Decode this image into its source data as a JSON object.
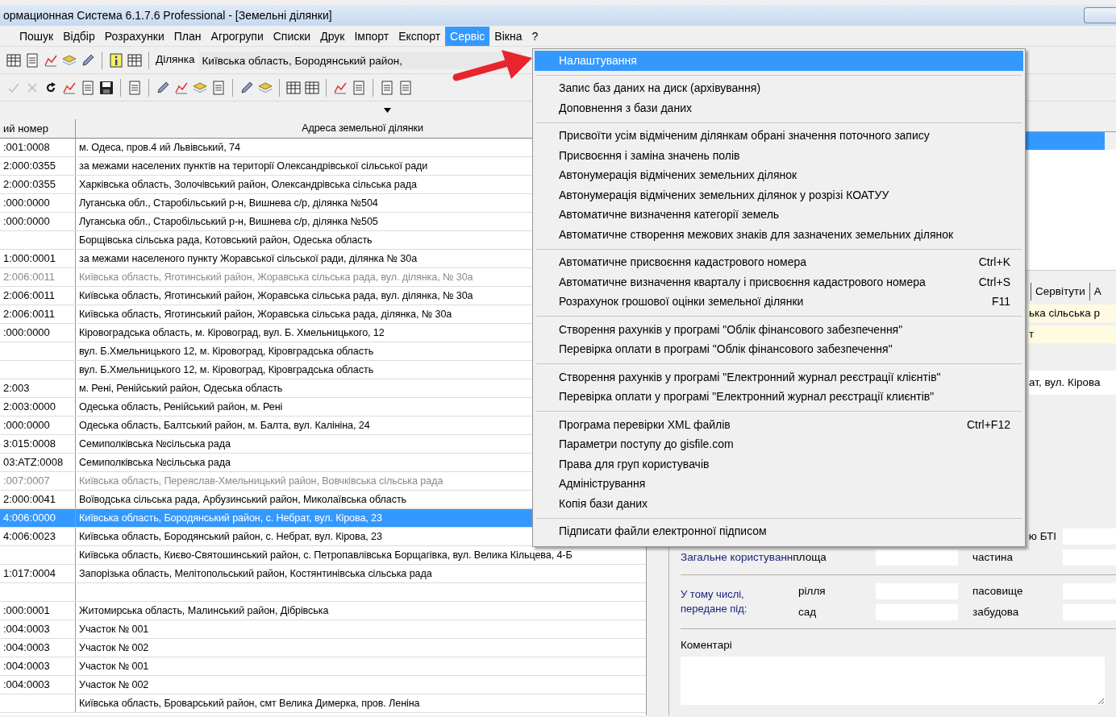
{
  "window": {
    "title": "ормационная Система 6.1.7.6 Professional - [Земельні ділянки]"
  },
  "menubar": [
    {
      "label": "Пошук",
      "selected": false
    },
    {
      "label": "Відбір",
      "selected": false
    },
    {
      "label": "Розрахунки",
      "selected": false
    },
    {
      "label": "План",
      "selected": false
    },
    {
      "label": "Агрогрупи",
      "selected": false
    },
    {
      "label": "Списки",
      "selected": false
    },
    {
      "label": "Друк",
      "selected": false
    },
    {
      "label": "Імпорт",
      "selected": false
    },
    {
      "label": "Експорт",
      "selected": false
    },
    {
      "label": "Сервіс",
      "selected": true
    },
    {
      "label": "Вікна",
      "selected": false
    },
    {
      "label": "?",
      "selected": false
    }
  ],
  "toolbar": {
    "plot_label": "Ділянка",
    "plot_value": "Київська область, Бородянський район,"
  },
  "table": {
    "columns": [
      "ий номер",
      "Адреса земельної ділянки"
    ],
    "rows": [
      {
        "number": ":001:0008",
        "address": "м. Одеса, пров.4 ий Львівський, 74",
        "muted": false,
        "selected": false
      },
      {
        "number": "2:000:0355",
        "address": "за межами населених пунктів на території Олександрівської сільської ради",
        "muted": false,
        "selected": false
      },
      {
        "number": "2:000:0355",
        "address": "Харківська область, Золочівський район, Олександрівська сільська рада",
        "muted": false,
        "selected": false
      },
      {
        "number": ":000:0000",
        "address": "Луганська обл., Старобільський р-н, Вишнева с/р, ділянка №504",
        "muted": false,
        "selected": false
      },
      {
        "number": ":000:0000",
        "address": "Луганська обл., Старобільський р-н, Вишнева с/р, ділянка №505",
        "muted": false,
        "selected": false
      },
      {
        "address": "Борщівська сільська рада, Котовський район, Одеська область",
        "muted": false,
        "selected": false
      },
      {
        "number": "1:000:0001",
        "address": "за межами населеного пункту Жоравської сільської ради, ділянка № 30а",
        "muted": false,
        "selected": false
      },
      {
        "number": "2:006:0011",
        "address": "Київська область, Яготинський район, Жоравська сільська рада, вул. ділянка, № 30а",
        "muted": true,
        "selected": false
      },
      {
        "number": "2:006:0011",
        "address": "Київська область, Яготинський район, Жоравська сільська рада, вул. ділянка, № 30а",
        "muted": false,
        "selected": false
      },
      {
        "number": "2:006:0011",
        "address": "Київська область, Яготинський район, Жоравська сільська рада,  ділянка, № 30а",
        "muted": false,
        "selected": false
      },
      {
        "number": ":000:0000",
        "address": "Кіровоградська область, м. Кіровоград, вул. Б. Хмельницького, 12",
        "muted": false,
        "selected": false
      },
      {
        "address": "вул. Б.Хмельницького 12, м. Кіровоград, Кіровградська область",
        "muted": false,
        "selected": false
      },
      {
        "address": "вул. Б.Хмельницького 12, м. Кіровоград, Кіровградська область",
        "muted": false,
        "selected": false
      },
      {
        "number": "2:003",
        "address": "м. Рені, Ренійський район, Одеська область",
        "muted": false,
        "selected": false
      },
      {
        "number": "2:003:0000",
        "address": "Одеська область, Ренійський район, м. Рені",
        "muted": false,
        "selected": false
      },
      {
        "number": ":000:0000",
        "address": "Одеська область, Балтський район, м. Балта, вул. Калініна, 24",
        "muted": false,
        "selected": false
      },
      {
        "number": "3:015:0008",
        "address": "Семиполківська №сільська рада",
        "muted": false,
        "selected": false
      },
      {
        "number": "03:ATZ:0008",
        "address": "Семиполківська №сільська рада",
        "muted": false,
        "selected": false
      },
      {
        "number": ":007:0007",
        "address": "Київська область, Переяслав-Хмельницький район, Вовчківська сільська рада",
        "muted": true,
        "selected": false
      },
      {
        "number": "2:000:0041",
        "address": "Воїводська сільська рада, Арбузинський район, Миколаївська область",
        "muted": false,
        "selected": false
      },
      {
        "number": "4:006:0000",
        "address": "Київська область, Бородянський район, с. Небрат, вул. Кірова, 23",
        "muted": false,
        "selected": true
      },
      {
        "number": "4:006:0023",
        "address": "Київська область, Бородянський район, с. Небрат, вул. Кірова, 23",
        "muted": false,
        "selected": false
      },
      {
        "address": "Київська область, Києво-Святошинський район, с. Петропавлівська Борщагівка, вул. Велика Кільцева, 4-Б",
        "muted": false,
        "selected": false
      },
      {
        "number": "1:017:0004",
        "address": "Запорізька область, Мелітопольський район, Костянтинівська сільська рада",
        "muted": false,
        "selected": false
      },
      {
        "selected": false
      },
      {
        "number": ":000:0001",
        "address": "Житомирська область, Малинський район, Дібрівська",
        "muted": false,
        "selected": false
      },
      {
        "number": ":004:0003",
        "address": "Участок № 001",
        "muted": false,
        "selected": false
      },
      {
        "number": ":004:0003",
        "address": "Участок № 002",
        "muted": false,
        "selected": false
      },
      {
        "number": ":004:0003",
        "address": "Участок № 001",
        "muted": false,
        "selected": false
      },
      {
        "number": ":004:0003",
        "address": "Участок № 002",
        "muted": false,
        "selected": false
      },
      {
        "address": "Київська область, Броварський район, смт Велика Димерка, пров. Леніна",
        "muted": false,
        "selected": false
      }
    ]
  },
  "right_panel": {
    "list_rows": [
      {
        "selected": true
      }
    ],
    "tabs": [
      {
        "label": "Сервітути",
        "selected": false
      },
      {
        "label": "А",
        "selected": false
      }
    ],
    "highlight_rows": [
      "ька сільська р",
      "т"
    ],
    "address_text": "ат, вул. Кірова",
    "form": {
      "bti_label": "ю БТІ",
      "common_use_label": "Загальне користуванн",
      "area_label": "площа",
      "part_label": "частина",
      "including_label": "У тому числі, передане під:",
      "land_labels": [
        "рілля",
        "пасовище",
        "сад",
        "забудова"
      ],
      "comments_label": "Коментарі"
    }
  },
  "service_menu": [
    {
      "kind": "item",
      "label": "Налаштування",
      "selected": true
    },
    {
      "kind": "separator"
    },
    {
      "kind": "item",
      "label": "Запис баз даних на диск (архівування)",
      "selected": false
    },
    {
      "kind": "item",
      "label": "Доповнення з бази даних",
      "selected": false
    },
    {
      "kind": "separator"
    },
    {
      "kind": "item",
      "label": "Присвоїти усім відміченим ділянкам обрані значення поточного запису",
      "selected": false
    },
    {
      "kind": "item",
      "label": "Присвоєння і заміна значень полів",
      "selected": false
    },
    {
      "kind": "item",
      "label": "Автонумерація відмічених земельних ділянок",
      "selected": false
    },
    {
      "kind": "item",
      "label": "Автонумерація відмічених земельних ділянок у розрізі КОАТУУ",
      "selected": false
    },
    {
      "kind": "item",
      "label": "Автоматичне визначення категорії земель",
      "selected": false
    },
    {
      "kind": "item",
      "label": "Автоматичне створення межових знаків для зазначених земельних ділянок",
      "selected": false
    },
    {
      "kind": "separator"
    },
    {
      "kind": "item",
      "label": "Автоматичне присвоєння кадастрового номера",
      "shortcut": "Ctrl+K",
      "selected": false
    },
    {
      "kind": "item",
      "label": "Автоматичне визначення кварталу і присвоєння кадастрового номера",
      "shortcut": "Ctrl+S",
      "selected": false
    },
    {
      "kind": "item",
      "label": "Розрахунок грошової оцінки земельної ділянки",
      "shortcut": "F11",
      "selected": false
    },
    {
      "kind": "separator"
    },
    {
      "kind": "item",
      "label": "Створення рахунків у програмі \"Облік фінансового забезпечення\"",
      "selected": false
    },
    {
      "kind": "item",
      "label": "Перевірка оплати в програмі \"Облік фінансового забезпечення\"",
      "selected": false
    },
    {
      "kind": "separator"
    },
    {
      "kind": "item",
      "label": "Створення рахунків у програмі \"Електронний журнал реєстрації клієнтів\"",
      "selected": false
    },
    {
      "kind": "item",
      "label": "Перевірка оплати у програмі \"Електронний журнал реєстрації клиєнтів\"",
      "selected": false
    },
    {
      "kind": "separator"
    },
    {
      "kind": "item",
      "label": "Програма перевірки XML файлів",
      "shortcut": "Ctrl+F12",
      "selected": false
    },
    {
      "kind": "item",
      "label": "Параметри поступу до gisfile.com",
      "selected": false
    },
    {
      "kind": "item",
      "label": "Права для груп користувачів",
      "selected": false
    },
    {
      "kind": "item",
      "label": "Адміністрування",
      "selected": false
    },
    {
      "kind": "item",
      "label": "Копія бази даних",
      "selected": false
    },
    {
      "kind": "separator"
    },
    {
      "kind": "item",
      "label": "Підписати файли електронної підписом",
      "selected": false
    }
  ]
}
